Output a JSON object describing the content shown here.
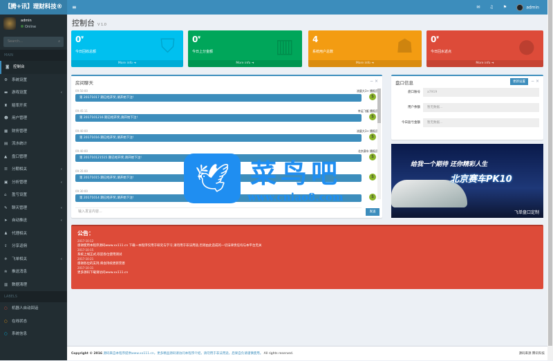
{
  "header": {
    "logo": "【腾+讯】理财科技®",
    "user": "admin",
    "icons": [
      "envelope-icon",
      "bell-icon",
      "flag-icon"
    ]
  },
  "sidebar": {
    "user_name": "admin",
    "status": "Online",
    "search_placeholder": "Search...",
    "section1": "MAIN",
    "items": [
      {
        "label": "控制台",
        "icon": "dashboard-icon",
        "arrow": false
      },
      {
        "label": "系统设置",
        "icon": "cog-icon",
        "arrow": false
      },
      {
        "label": "游戏设置",
        "icon": "gamepad-icon",
        "arrow": true
      },
      {
        "label": "赔率开奖",
        "icon": "trophy-icon",
        "arrow": false
      },
      {
        "label": "用户管理",
        "icon": "user-icon",
        "arrow": false
      },
      {
        "label": "财务管理",
        "icon": "money-icon",
        "arrow": false
      },
      {
        "label": "流水统计",
        "icon": "chart-icon",
        "arrow": false
      },
      {
        "label": "盘口管理",
        "icon": "warning-icon",
        "arrow": false
      },
      {
        "label": "分期相关",
        "icon": "list-icon",
        "arrow": true
      },
      {
        "label": "分析管理",
        "icon": "file-icon",
        "arrow": true
      },
      {
        "label": "盈亏设置",
        "icon": "home-icon",
        "arrow": false
      },
      {
        "label": "聊天管理",
        "icon": "comment-icon",
        "arrow": true
      },
      {
        "label": "自动推送",
        "icon": "send-icon",
        "arrow": true
      },
      {
        "label": "代理相关",
        "icon": "users-icon",
        "arrow": false
      },
      {
        "label": "分享返佣",
        "icon": "share-icon",
        "arrow": false
      },
      {
        "label": "飞单相关",
        "icon": "plane-icon",
        "arrow": true
      },
      {
        "label": "推送消息",
        "icon": "wifi-icon",
        "arrow": false
      },
      {
        "label": "数据清理",
        "icon": "trash-icon",
        "arrow": false
      }
    ],
    "section2": "LABELS",
    "labels": [
      {
        "label": "机器人自动回话",
        "color": "#dd4b39"
      },
      {
        "label": "在线状态",
        "color": "#f39c12"
      },
      {
        "label": "系统信息",
        "color": "#00c0ef"
      }
    ]
  },
  "page": {
    "title": "控制台",
    "subtitle": "V 1.0"
  },
  "stats": [
    {
      "value": "0",
      "unit": "¥",
      "label": "今日回收总额",
      "more": "More info",
      "color": "#00c0ef",
      "icon": "bag-icon"
    },
    {
      "value": "0",
      "unit": "¥",
      "label": "今日上分金额",
      "more": "More info",
      "color": "#00a65a",
      "icon": "bar-chart-icon"
    },
    {
      "value": "4",
      "unit": "",
      "label": "系统用户总数",
      "more": "More info",
      "color": "#f39c12",
      "icon": "user-add-icon"
    },
    {
      "value": "0",
      "unit": "¥",
      "label": "今日回水返点",
      "more": "More info",
      "color": "#dd4b39",
      "icon": "pie-chart-icon"
    }
  ],
  "chat": {
    "title": "房间聊天",
    "input_placeholder": "输入发言内容...",
    "send": "发送",
    "messages": [
      {
        "time": "09:50:00",
        "who": "流量大3+ 播报员",
        "text": "第 20171017 期已经开奖,请开始下注!"
      },
      {
        "time": "09:45:11",
        "who": "幸运飞艇 播报员",
        "text": "第 2017101216 期已经开奖,请开始下注!"
      },
      {
        "time": "09:40:00",
        "who": "流量大3+ 播报员",
        "text": "第 20171016 期已经开奖,请开始下注!"
      },
      {
        "time": "09:40:00",
        "who": "北京赛车 播报员",
        "text": "第 201710121515 期已经开奖,请开始下注!"
      },
      {
        "time": "09:35:00",
        "who": "",
        "text": "第 20171015 期已经开奖,请开始下注!"
      },
      {
        "time": "09:30:00",
        "who": "",
        "text": "第 20171014 期已经开奖,请开始下注!"
      }
    ]
  },
  "panel": {
    "title": "盘口信息",
    "button": "更新设置",
    "fields": [
      {
        "label": "盘口账号",
        "value": "a7919"
      },
      {
        "label": "用户余额",
        "value": "暂无数据..."
      },
      {
        "label": "今日盈亏金额",
        "value": "暂无数据..."
      }
    ]
  },
  "banner": {
    "line1": "给我一个期待 还你精彩人生",
    "line2": "北京赛车PK10",
    "line3": "飞单盘口定制"
  },
  "notice": {
    "title": "公告：",
    "entries": [
      {
        "date": "2017-10-12",
        "text": "感谢使用本程序源码www.xx111.cn 下载一本程序仅用于研究与学习,请勿用于非法用途,否则由此造成的一切法律责任均与本平台无关"
      },
      {
        "date": "2017-10-15",
        "text": "系统上线正式,欢迎各位使用测试"
      },
      {
        "date": "2017-10-21",
        "text": "感谢各位的支持,将会持续更新完善"
      },
      {
        "date": "2017-10-31",
        "text": "更多源码下载请访问www.xx111.cn"
      }
    ]
  },
  "footer": {
    "copyright": "Copyright © 2016",
    "link": "源码来自本程序提供www.xx111.cn，更多精品源码请访问本程序介绍，请勿用于非法用途，后果自负请谨慎使用。",
    "rights": "All rights reserved.",
    "version": "源码来源 腾讯科技"
  },
  "watermark": {
    "cn": "菜鸟吧",
    "url": "www.cniao8.com"
  }
}
